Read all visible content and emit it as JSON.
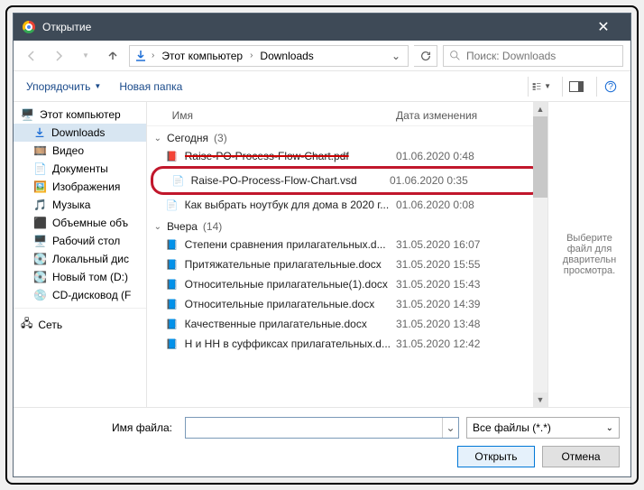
{
  "title": "Открытие",
  "breadcrumb": {
    "root": "Этот компьютер",
    "folder": "Downloads"
  },
  "search": {
    "placeholder": "Поиск: Downloads"
  },
  "toolbar": {
    "organize": "Упорядочить",
    "new_folder": "Новая папка"
  },
  "columns": {
    "name": "Имя",
    "date": "Дата изменения"
  },
  "tree": {
    "this_pc": "Этот компьютер",
    "downloads": "Downloads",
    "video": "Видео",
    "documents": "Документы",
    "pictures": "Изображения",
    "music": "Музыка",
    "volumes": "Объемные объ",
    "desktop": "Рабочий стол",
    "local_disk": "Локальный дис",
    "new_vol": "Новый том (D:)",
    "cd": "CD-дисковод (F",
    "network": "Сеть"
  },
  "groups": {
    "today": {
      "label": "Сегодня",
      "count": "(3)"
    },
    "yesterday": {
      "label": "Вчера",
      "count": "(14)"
    }
  },
  "files_today": [
    {
      "name": "Raise-PO-Process-Flow-Chart.pdf",
      "date": "01.06.2020 0:48",
      "icon": "pdf"
    },
    {
      "name": "Raise-PO-Process-Flow-Chart.vsd",
      "date": "01.06.2020 0:35",
      "icon": "file"
    },
    {
      "name": "Как выбрать ноутбук для дома в 2020 г...",
      "date": "01.06.2020 0:08",
      "icon": "doc"
    }
  ],
  "files_yesterday": [
    {
      "name": "Степени сравнения прилагательных.d...",
      "date": "31.05.2020 16:07"
    },
    {
      "name": "Притяжательные прилагательные.docx",
      "date": "31.05.2020 15:55"
    },
    {
      "name": "Относительные прилагательные(1).docx",
      "date": "31.05.2020 15:43"
    },
    {
      "name": "Относительные прилагательные.docx",
      "date": "31.05.2020 14:39"
    },
    {
      "name": "Качественные прилагательные.docx",
      "date": "31.05.2020 13:48"
    },
    {
      "name": "Н и НН в суффиксах прилагательных.d...",
      "date": "31.05.2020 12:42"
    }
  ],
  "preview": "Выберите файл для дварительн просмотра.",
  "footer": {
    "filename_label": "Имя файла:",
    "filter": "Все файлы (*.*)",
    "open": "Открыть",
    "cancel": "Отмена"
  }
}
